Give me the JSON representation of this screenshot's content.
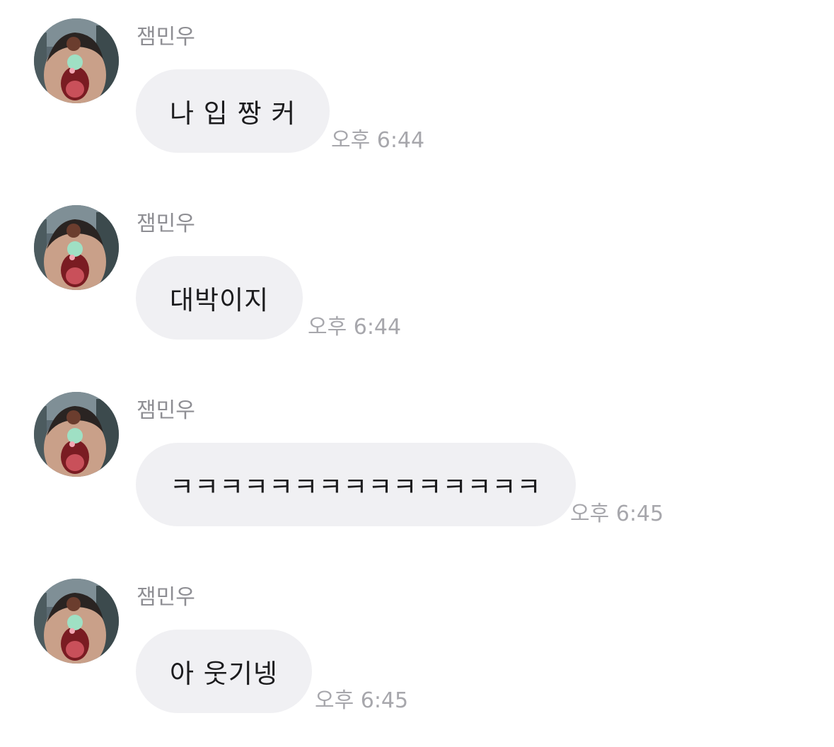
{
  "messages": [
    {
      "sender": "잼민우",
      "text": "나 입 짱 커",
      "time": "오후 6:44"
    },
    {
      "sender": "잼민우",
      "text": "대박이지",
      "time": "오후 6:44"
    },
    {
      "sender": "잼민우",
      "text": "ㅋㅋㅋㅋㅋㅋㅋㅋㅋㅋㅋㅋㅋㅋㅋ",
      "time": "오후 6:45"
    },
    {
      "sender": "잼민우",
      "text": "아 웃기넹",
      "time": "오후 6:45"
    }
  ],
  "colors": {
    "bubble_background": "#f0f0f3",
    "message_text": "#1c1c1e",
    "sender_name": "#8e8e93",
    "timestamp": "#a7a7ac"
  },
  "icons": {
    "avatar": "profile-photo-avatar"
  }
}
